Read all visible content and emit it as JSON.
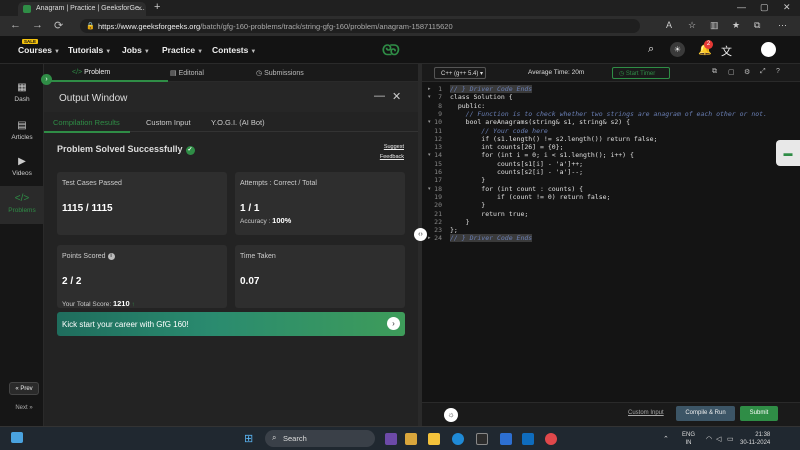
{
  "browser": {
    "tab_title": "Anagram | Practice | GeeksforGe...",
    "url_domain": "https://www.geeksforgeeks.org",
    "url_path": "/batch/gfg-160-problems/track/string-gfg-160/problem/anagram-1587115620"
  },
  "site_nav": {
    "sale_badge": "SALE",
    "items": [
      "Courses",
      "Tutorials",
      "Jobs",
      "Practice",
      "Contests"
    ],
    "logo": "ᘓᘐ",
    "notification_count": "2"
  },
  "rail": {
    "items": [
      "Dash",
      "Articles",
      "Videos",
      "Problems"
    ],
    "prev": "« Prev",
    "next": "Next »"
  },
  "left_tabs": [
    "Problem",
    "Editorial",
    "Submissions"
  ],
  "output_window": {
    "title": "Output Window",
    "subtabs": [
      "Compilation Results",
      "Custom Input",
      "Y.O.G.I. (AI Bot)"
    ],
    "status": "Problem Solved Successfully",
    "suggest": "Suggest",
    "feedback": "Feedback",
    "test_cases_label": "Test Cases Passed",
    "test_cases_value": "1115 / 1115",
    "attempts_label": "Attempts : Correct / Total",
    "attempts_value": "1 / 1",
    "accuracy_label": "Accuracy :",
    "accuracy_value": "100%",
    "points_label": "Points Scored",
    "points_value": "2 / 2",
    "total_score_label": "Your Total Score:",
    "total_score_value": "1210",
    "time_label": "Time Taken",
    "time_value": "0.07",
    "banner": "Kick start your career with GfG 160!"
  },
  "editor": {
    "language": "C++ (g++ 5.4)",
    "avg_time_label": "Average Time:",
    "avg_time_value": "20m",
    "start_timer": "Start Timer",
    "lines": [
      {
        "n": "1",
        "text": "// } Driver Code Ends",
        "cls": "cmt",
        "fold": "▸"
      },
      {
        "n": "7",
        "text": "class Solution {",
        "cls": "",
        "fold": "▾"
      },
      {
        "n": "8",
        "text": "  public:",
        "cls": "",
        "fold": ""
      },
      {
        "n": "9",
        "text": "    // Function is to check whether two strings are anagram of each other or not.",
        "cls": "cmt",
        "fold": ""
      },
      {
        "n": "10",
        "text": "    bool areAnagrams(string& s1, string& s2) {",
        "cls": "",
        "fold": "▾"
      },
      {
        "n": "11",
        "text": "        // Your code here",
        "cls": "cmt",
        "fold": ""
      },
      {
        "n": "12",
        "text": "        if (s1.length() != s2.length()) return false;",
        "cls": "",
        "fold": ""
      },
      {
        "n": "13",
        "text": "        int counts[26] = {0};",
        "cls": "",
        "fold": ""
      },
      {
        "n": "14",
        "text": "        for (int i = 0; i < s1.length(); i++) {",
        "cls": "",
        "fold": "▾"
      },
      {
        "n": "15",
        "text": "            counts[s1[i] - 'a']++;",
        "cls": "",
        "fold": ""
      },
      {
        "n": "16",
        "text": "            counts[s2[i] - 'a']--;",
        "cls": "",
        "fold": ""
      },
      {
        "n": "17",
        "text": "        }",
        "cls": "",
        "fold": ""
      },
      {
        "n": "18",
        "text": "        for (int count : counts) {",
        "cls": "",
        "fold": "▾"
      },
      {
        "n": "19",
        "text": "            if (count != 0) return false;",
        "cls": "",
        "fold": ""
      },
      {
        "n": "20",
        "text": "        }",
        "cls": "",
        "fold": ""
      },
      {
        "n": "21",
        "text": "        return true;",
        "cls": "",
        "fold": ""
      },
      {
        "n": "22",
        "text": "    }",
        "cls": "",
        "fold": ""
      },
      {
        "n": "23",
        "text": "};",
        "cls": "",
        "fold": ""
      },
      {
        "n": "24",
        "text": "// } Driver Code Ends",
        "cls": "cmt",
        "fold": "▸"
      }
    ],
    "custom_input": "Custom Input",
    "compile_run": "Compile & Run",
    "submit": "Submit"
  },
  "taskbar": {
    "search_placeholder": "Search",
    "lang_line1": "ENG",
    "lang_line2": "IN",
    "time": "21:38",
    "date": "30-11-2024"
  },
  "colors": {
    "accent": "#2f8d46",
    "background": "#1e1e1e"
  }
}
